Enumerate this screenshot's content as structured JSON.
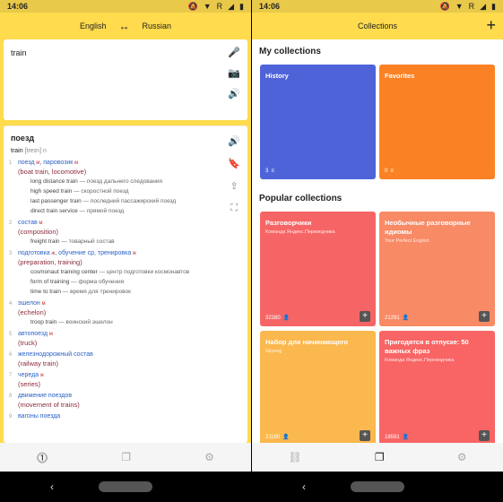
{
  "status": {
    "time": "14:06",
    "carrier": "R"
  },
  "translator": {
    "lang_from": "English",
    "lang_to": "Russian",
    "swap_icon": "↔",
    "input_text": "train",
    "headword": "поезд",
    "source_word": "train",
    "transcription": "[treɪn]",
    "pos": "n",
    "entries": [
      {
        "num": "1",
        "words": "поезд",
        "gender": "м",
        "extra": ", паровозик",
        "extra_gender": "м",
        "meaning": "(boat train, locomotive)",
        "examples": [
          [
            "long distance train",
            "поезд дальнего следования"
          ],
          [
            "high speed train",
            "скоростной поезд"
          ],
          [
            "last passenger train",
            "последний пассажирский поезд"
          ],
          [
            "direct train service",
            "прямой поезд"
          ]
        ]
      },
      {
        "num": "2",
        "words": "состав",
        "gender": "м",
        "extra": "",
        "extra_gender": "",
        "meaning": "(composition)",
        "examples": [
          [
            "freight train",
            "товарный состав"
          ]
        ]
      },
      {
        "num": "3",
        "words": "подготовка",
        "gender": "ж",
        "extra": ", обучение ср, тренировка",
        "extra_gender": "ж",
        "meaning": "(preparation, training)",
        "examples": [
          [
            "cosmonaut training center",
            "центр подготовки космонавтов"
          ],
          [
            "form of training",
            "форма обучения"
          ],
          [
            "time to train",
            "время для тренировок"
          ]
        ]
      },
      {
        "num": "4",
        "words": "эшелон",
        "gender": "м",
        "extra": "",
        "extra_gender": "",
        "meaning": "(echelon)",
        "examples": [
          [
            "troop train",
            "воинский эшелон"
          ]
        ]
      },
      {
        "num": "5",
        "words": "автопоезд",
        "gender": "м",
        "extra": "",
        "extra_gender": "",
        "meaning": "(truck)",
        "examples": []
      },
      {
        "num": "6",
        "words": "железнодорожный состав",
        "gender": "",
        "extra": "",
        "extra_gender": "",
        "meaning": "(railway train)",
        "examples": []
      },
      {
        "num": "7",
        "words": "череда",
        "gender": "ж",
        "extra": "",
        "extra_gender": "",
        "meaning": "(series)",
        "examples": []
      },
      {
        "num": "8",
        "words": "движение поездов",
        "gender": "",
        "extra": "",
        "extra_gender": "",
        "meaning": "(movement of trains)",
        "examples": []
      },
      {
        "num": "9",
        "words": "вагоны поезда",
        "gender": "",
        "extra": "",
        "extra_gender": "",
        "meaning": "",
        "examples": []
      }
    ]
  },
  "collections": {
    "title": "Collections",
    "my_title": "My collections",
    "popular_title": "Popular collections",
    "my": [
      {
        "name": "History",
        "count": "3",
        "color": "#4f63d9"
      },
      {
        "name": "Favorites",
        "count": "0",
        "color": "#fb8224"
      }
    ],
    "popular": [
      {
        "name": "Разговорчики",
        "sub": "Команда Яндекс.Переводчика",
        "count": "32380",
        "color": "#f66565"
      },
      {
        "name": "Необычные разговорные идиомы",
        "sub": "Your Perfect English",
        "count": "21291",
        "color": "#f88a65"
      },
      {
        "name": "Набор для начинающего",
        "sub": "Skyeng",
        "count": "21160",
        "color": "#fbb84e"
      },
      {
        "name": "Пригодятся в отпуске: 50 важных фраз",
        "sub": "Команда Яндекс.Переводчика",
        "count": "18591",
        "color": "#f96464"
      }
    ]
  }
}
